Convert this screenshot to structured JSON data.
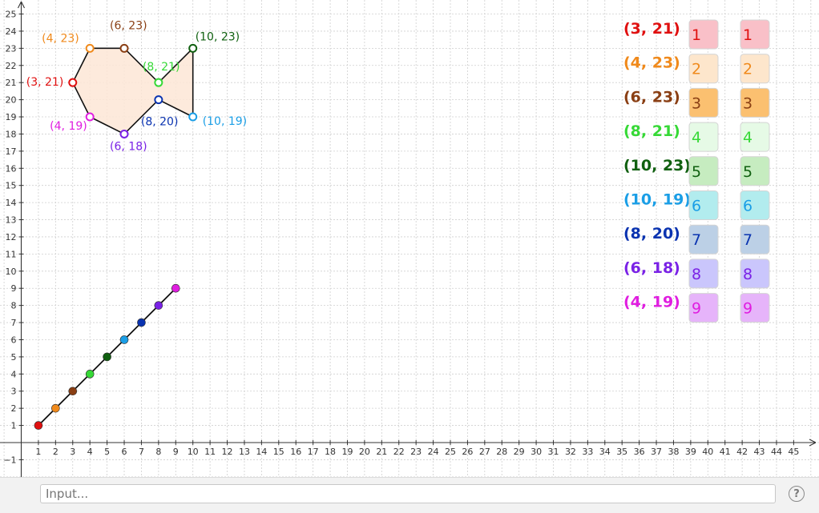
{
  "grid": {
    "x_ticks": [
      "1",
      "2",
      "3",
      "4",
      "5",
      "6",
      "7",
      "8",
      "9",
      "10",
      "11",
      "12",
      "13",
      "14",
      "15",
      "16",
      "17",
      "18",
      "19",
      "20",
      "21",
      "22",
      "23",
      "24",
      "25",
      "26",
      "27",
      "28",
      "29",
      "30",
      "31",
      "32",
      "33",
      "34",
      "35",
      "36",
      "37",
      "38",
      "39",
      "40",
      "41",
      "42",
      "43",
      "44",
      "45"
    ],
    "y_ticks": [
      "−1",
      "1",
      "2",
      "3",
      "4",
      "5",
      "6",
      "7",
      "8",
      "9",
      "10",
      "11",
      "12",
      "13",
      "14",
      "15",
      "16",
      "17",
      "18",
      "19",
      "20",
      "21",
      "22",
      "23",
      "24",
      "25"
    ]
  },
  "polygon": {
    "fill_color": "#fde6d6",
    "vertices": [
      {
        "x": 3,
        "y": 21,
        "label": "(3, 21)",
        "color": "#e01010"
      },
      {
        "x": 4,
        "y": 23,
        "label": "(4, 23)",
        "color": "#f08a1c"
      },
      {
        "x": 6,
        "y": 23,
        "label": "(6, 23)",
        "color": "#8a3f14"
      },
      {
        "x": 8,
        "y": 21,
        "label": "(8, 21)",
        "color": "#36d936"
      },
      {
        "x": 10,
        "y": 23,
        "label": "(10, 23)",
        "color": "#106010"
      },
      {
        "x": 10,
        "y": 19,
        "label": "(10, 19)",
        "color": "#1a9ee6"
      },
      {
        "x": 8,
        "y": 20,
        "label": "(8, 20)",
        "color": "#0a33b0"
      },
      {
        "x": 6,
        "y": 18,
        "label": "(6, 18)",
        "color": "#7a22e6"
      },
      {
        "x": 4,
        "y": 19,
        "label": "(4, 19)",
        "color": "#e01ee0"
      }
    ]
  },
  "line_points": [
    {
      "x": 1,
      "y": 1,
      "color": "#e01010"
    },
    {
      "x": 2,
      "y": 2,
      "color": "#f08a1c"
    },
    {
      "x": 3,
      "y": 3,
      "color": "#8a3f14"
    },
    {
      "x": 4,
      "y": 4,
      "color": "#36d936"
    },
    {
      "x": 5,
      "y": 5,
      "color": "#106010"
    },
    {
      "x": 6,
      "y": 6,
      "color": "#1a9ee6"
    },
    {
      "x": 7,
      "y": 7,
      "color": "#0a33b0"
    },
    {
      "x": 8,
      "y": 8,
      "color": "#7a22e6"
    },
    {
      "x": 9,
      "y": 9,
      "color": "#e01ee0"
    }
  ],
  "legend": [
    {
      "coord": "(3, 21)",
      "num": "1",
      "color": "#e01010",
      "bg": "#f9c0c8"
    },
    {
      "coord": "(4, 23)",
      "num": "2",
      "color": "#f08a1c",
      "bg": "#fde6cc"
    },
    {
      "coord": "(6, 23)",
      "num": "3",
      "color": "#8a3f14",
      "bg": "#fbc070"
    },
    {
      "coord": "(8, 21)",
      "num": "4",
      "color": "#36d936",
      "bg": "#e6fae6"
    },
    {
      "coord": "(10, 23)",
      "num": "5",
      "color": "#106010",
      "bg": "#c6ecc0"
    },
    {
      "coord": "(10, 19)",
      "num": "6",
      "color": "#1a9ee6",
      "bg": "#b2ecee"
    },
    {
      "coord": "(8, 20)",
      "num": "7",
      "color": "#0a33b0",
      "bg": "#bcd0e6"
    },
    {
      "coord": "(6, 18)",
      "num": "8",
      "color": "#7a22e6",
      "bg": "#cac6fc"
    },
    {
      "coord": "(4, 19)",
      "num": "9",
      "color": "#e01ee0",
      "bg": "#e6b4fa"
    }
  ],
  "input_bar": {
    "placeholder": "Input...",
    "help": "?"
  }
}
